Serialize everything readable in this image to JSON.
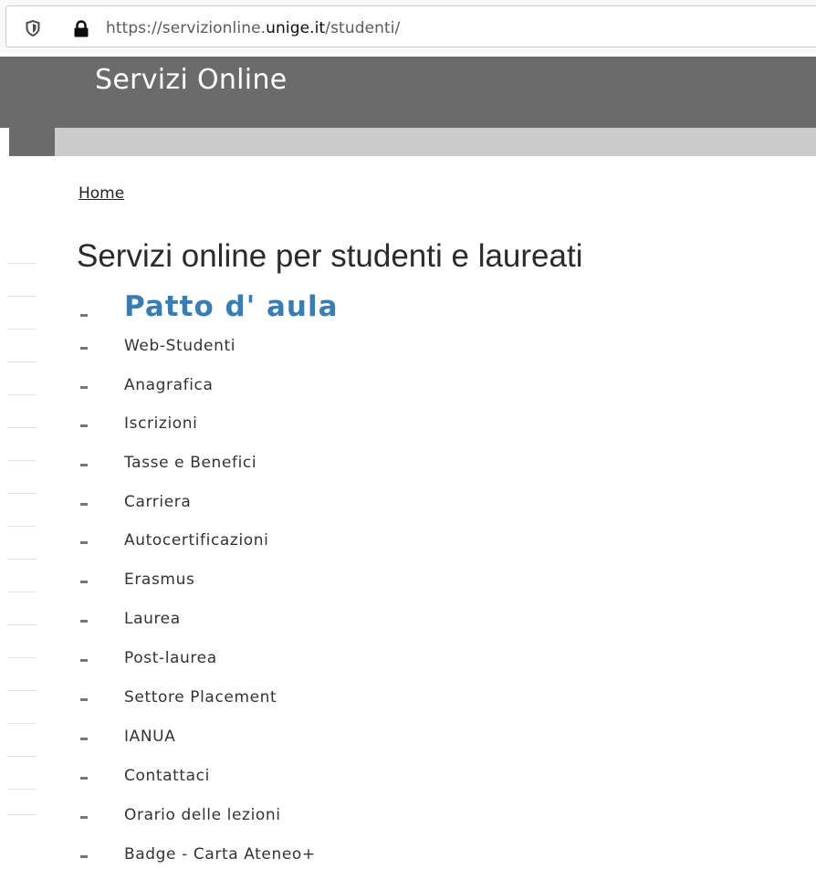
{
  "browser": {
    "url_prefix": "https://servizionline.",
    "url_host": "unige.it",
    "url_suffix": "/studenti/",
    "icons": [
      "shield-icon",
      "lock-icon"
    ]
  },
  "header": {
    "title": "Servizi Online",
    "colors": {
      "dark_band": "#6b6b6b",
      "light_band": "#cccccc"
    }
  },
  "breadcrumb": {
    "home_label": "Home"
  },
  "main": {
    "title": "Servizi online per studenti e laureati",
    "featured": {
      "label": "Patto d' aula",
      "color": "#3b7db0"
    },
    "items": [
      {
        "label": "Web-Studenti"
      },
      {
        "label": "Anagrafica"
      },
      {
        "label": "Iscrizioni"
      },
      {
        "label": "Tasse e Benefici"
      },
      {
        "label": "Carriera"
      },
      {
        "label": "Autocertificazioni"
      },
      {
        "label": "Erasmus"
      },
      {
        "label": "Laurea"
      },
      {
        "label": "Post-laurea"
      },
      {
        "label": "Settore Placement"
      },
      {
        "label": "IANUA"
      },
      {
        "label": "Contattaci"
      },
      {
        "label": "Orario delle lezioni"
      },
      {
        "label": "Badge - Carta Ateneo+"
      }
    ]
  }
}
